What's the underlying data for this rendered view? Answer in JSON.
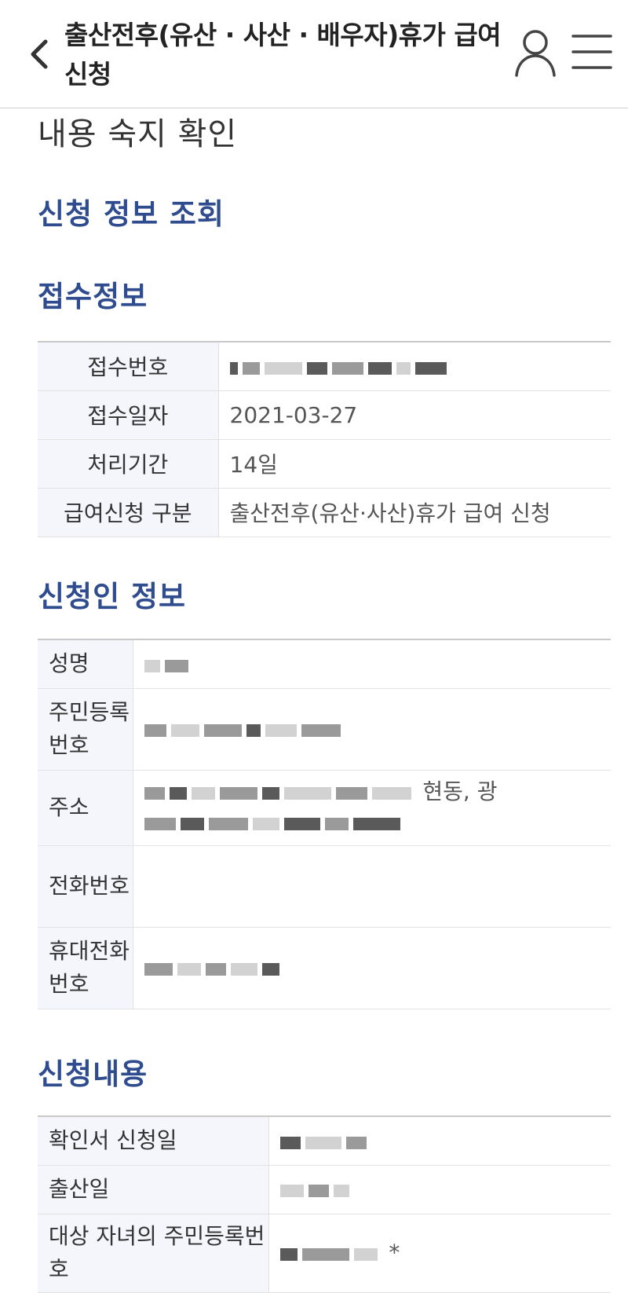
{
  "header": {
    "title": "출산전후(유산 · 사산 · 배우자)휴가 급여 신청",
    "back_icon": "chevron-left-icon",
    "user_icon": "user-icon",
    "menu_icon": "hamburger-menu-icon"
  },
  "page": {
    "heading": "내용 숙지 확인"
  },
  "lookup": {
    "title": "신청 정보 조회"
  },
  "receipt": {
    "title": "접수정보",
    "rows": [
      {
        "label": "접수번호",
        "value": ""
      },
      {
        "label": "접수일자",
        "value": "2021-03-27"
      },
      {
        "label": "처리기간",
        "value": "14일"
      },
      {
        "label": "급여신청 구분",
        "value": "출산전후(유산·사산)휴가 급여 신청"
      }
    ]
  },
  "applicant": {
    "title": "신청인 정보",
    "rows": [
      {
        "label": "성명",
        "value": ""
      },
      {
        "label": "주민등록번호",
        "value": ""
      },
      {
        "label": "주소",
        "value": "현동, 광"
      },
      {
        "label": "전화번호",
        "value": ""
      },
      {
        "label": "휴대전화번호",
        "value": ""
      }
    ]
  },
  "request": {
    "title": "신청내용",
    "rows": [
      {
        "label": "확인서 신청일",
        "value": ""
      },
      {
        "label": "출산일",
        "value": ""
      },
      {
        "label": "대상 자녀의 주민등록번호",
        "value": "*"
      }
    ]
  },
  "colors": {
    "accent": "#2f4c8f",
    "header_bg": "#f4f6fb"
  }
}
